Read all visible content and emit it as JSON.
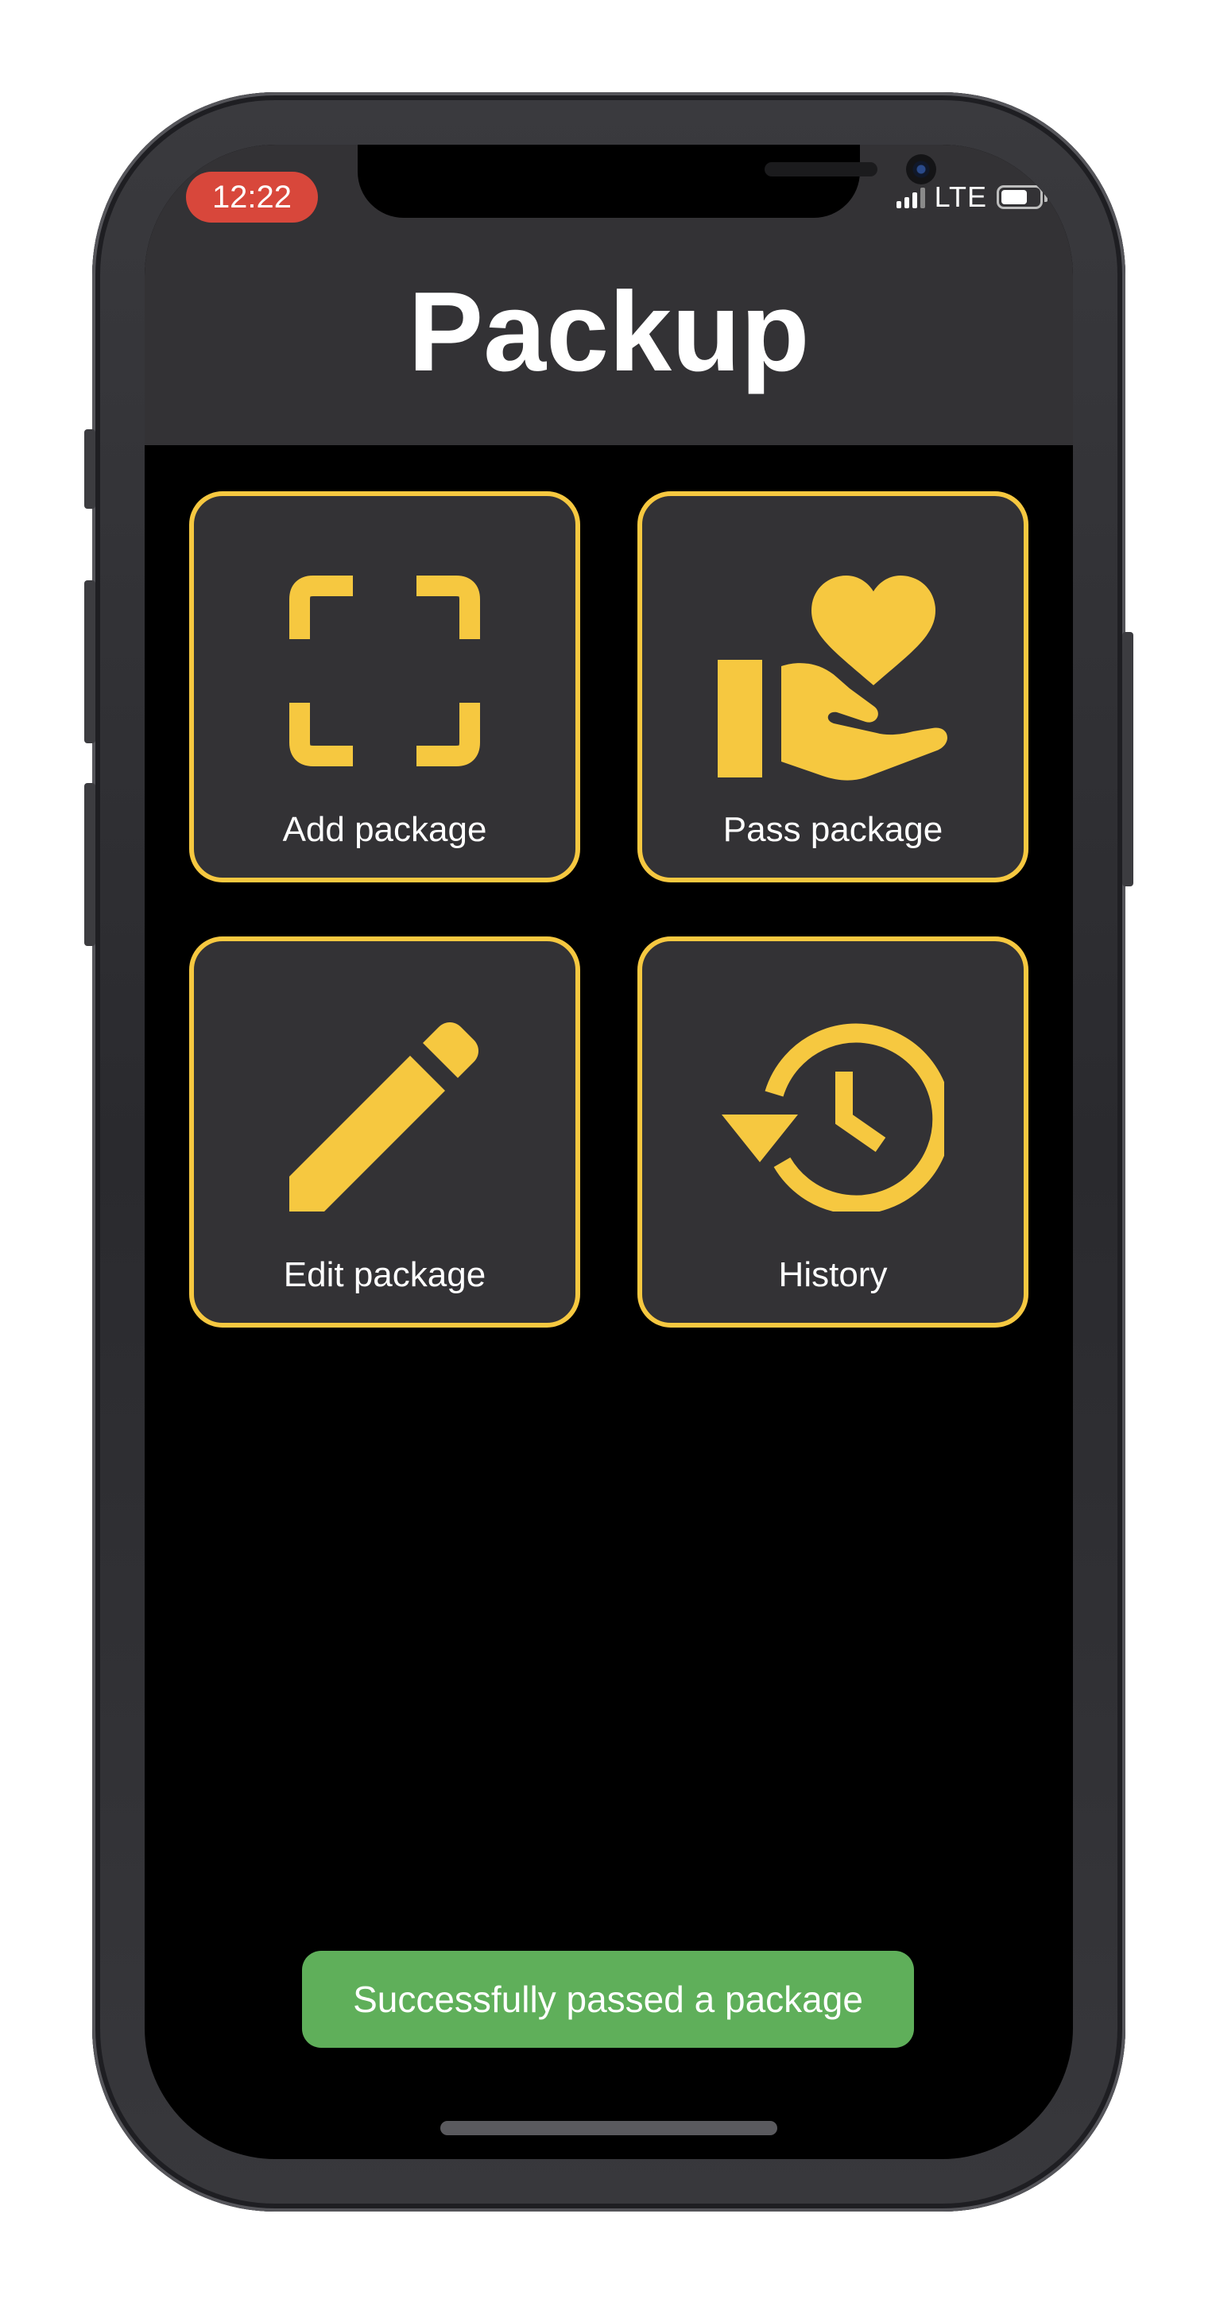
{
  "status_bar": {
    "time": "12:22",
    "network": "LTE",
    "battery_level": 0.7
  },
  "header": {
    "title": "Packup"
  },
  "tiles": [
    {
      "label": "Add package",
      "icon": "scan-frame-icon"
    },
    {
      "label": "Pass package",
      "icon": "hand-heart-icon"
    },
    {
      "label": "Edit package",
      "icon": "pencil-icon"
    },
    {
      "label": "History",
      "icon": "history-clock-icon"
    }
  ],
  "toast": {
    "message": "Successfully passed a package"
  },
  "colors": {
    "accent": "#f6c840",
    "header_bg": "#333235",
    "tile_bg": "#333235",
    "toast_bg": "#5faf5a",
    "time_pill_bg": "#d8473b"
  }
}
